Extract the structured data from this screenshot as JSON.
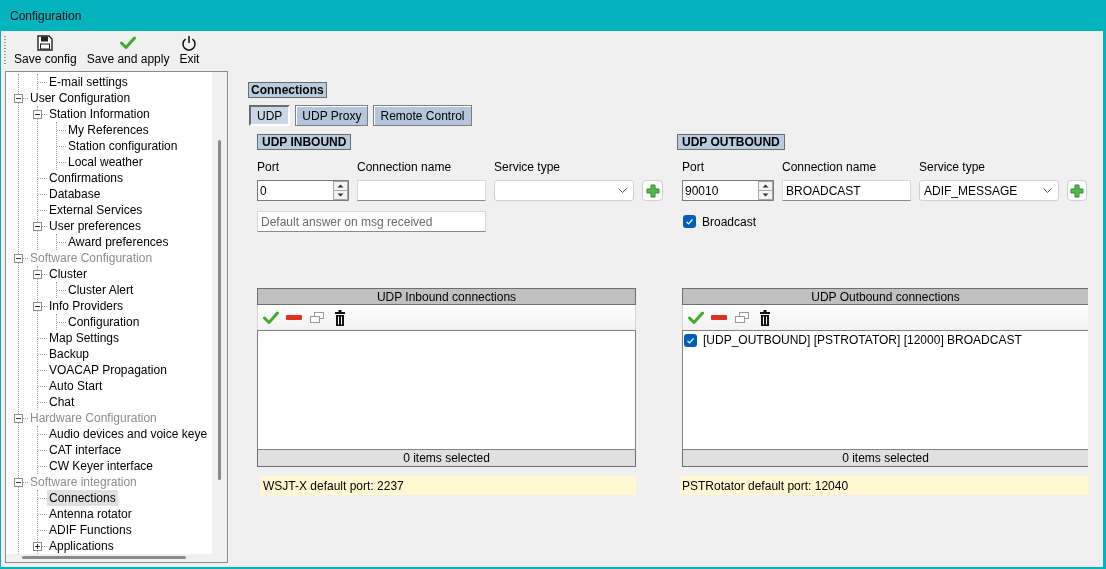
{
  "window": {
    "title": "Configuration"
  },
  "toolbar": [
    {
      "kind": "save",
      "label": "Save config"
    },
    {
      "kind": "apply",
      "label": "Save and apply"
    },
    {
      "kind": "exit",
      "label": "Exit"
    }
  ],
  "tree": [
    {
      "children": [
        {
          "label": "E-mail settings",
          "selected": false
        }
      ]
    },
    {
      "label": "User Configuration",
      "disabled": false,
      "selected": false,
      "expanded": true,
      "children": [
        {
          "label": "Station Information",
          "selected": false,
          "expanded": true,
          "children": [
            {
              "label": "My References",
              "selected": false
            },
            {
              "label": "Station configuration",
              "selected": false
            },
            {
              "label": "Local weather",
              "selected": false
            }
          ]
        },
        {
          "label": "Confirmations",
          "selected": false
        },
        {
          "label": "Database",
          "selected": false
        },
        {
          "label": "External Services",
          "selected": false
        },
        {
          "label": "User preferences",
          "selected": false,
          "expanded": true,
          "children": [
            {
              "label": "Award preferences",
              "selected": false
            }
          ]
        }
      ]
    },
    {
      "label": "Software Configuration",
      "disabled": true,
      "selected": false,
      "expanded": true,
      "children": [
        {
          "label": "Cluster",
          "selected": false,
          "expanded": true,
          "children": [
            {
              "label": "Cluster Alert",
              "selected": false
            }
          ]
        },
        {
          "label": "Info Providers",
          "selected": false,
          "expanded": true,
          "children": [
            {
              "label": "Configuration",
              "selected": false
            }
          ]
        },
        {
          "label": "Map Settings",
          "selected": false
        },
        {
          "label": "Backup",
          "selected": false
        },
        {
          "label": "VOACAP Propagation",
          "selected": false
        },
        {
          "label": "Auto Start",
          "selected": false
        },
        {
          "label": "Chat",
          "selected": false
        }
      ]
    },
    {
      "label": "Hardware Configuration",
      "disabled": true,
      "selected": false,
      "expanded": true,
      "children": [
        {
          "label": "Audio devices and voice keye",
          "selected": false
        },
        {
          "label": "CAT interface",
          "selected": false
        },
        {
          "label": "CW Keyer interface",
          "selected": false
        }
      ]
    },
    {
      "label": "Software integration",
      "disabled": true,
      "selected": false,
      "expanded": true,
      "children": [
        {
          "label": "Connections",
          "selected": true
        },
        {
          "label": "Antenna rotator",
          "selected": false
        },
        {
          "label": "ADIF Functions",
          "selected": false
        },
        {
          "label": "Applications",
          "selected": false,
          "expanded": false
        }
      ]
    }
  ],
  "panel": {
    "title": "Connections",
    "tabs": [
      {
        "label": "UDP",
        "selected": true
      },
      {
        "label": "UDP Proxy",
        "selected": false
      },
      {
        "label": "Remote Control",
        "selected": false
      }
    ],
    "sections": [
      {
        "title": "UDP INBOUND",
        "port": {
          "label": "Port",
          "value": "0"
        },
        "connection_name": {
          "label": "Connection name"
        },
        "service_type": {
          "label": "Service type"
        },
        "answer": {
          "placeholder": "Default answer on msg received"
        },
        "list": {
          "title": "UDP Inbound connections",
          "footer": "0 items selected"
        },
        "note": "WSJT-X default port: 2237"
      },
      {
        "title": "UDP OUTBOUND",
        "port": {
          "label": "Port",
          "value": "90010"
        },
        "connection_name": {
          "label": "Connection name",
          "value": "BROADCAST"
        },
        "service_type": {
          "label": "Service type",
          "value": "ADIF_MESSAGE"
        },
        "broadcast": {
          "label": "Broadcast",
          "checked": true
        },
        "list": {
          "title": "UDP Outbound connections",
          "items": [
            {
              "label": "[UDP_OUTBOUND] [PSTROTATOR] [12000] BROADCAST",
              "checked": true,
              "selected": false
            }
          ],
          "footer": "0 items selected"
        },
        "note": "PSTRotator default port: 12040"
      }
    ]
  }
}
